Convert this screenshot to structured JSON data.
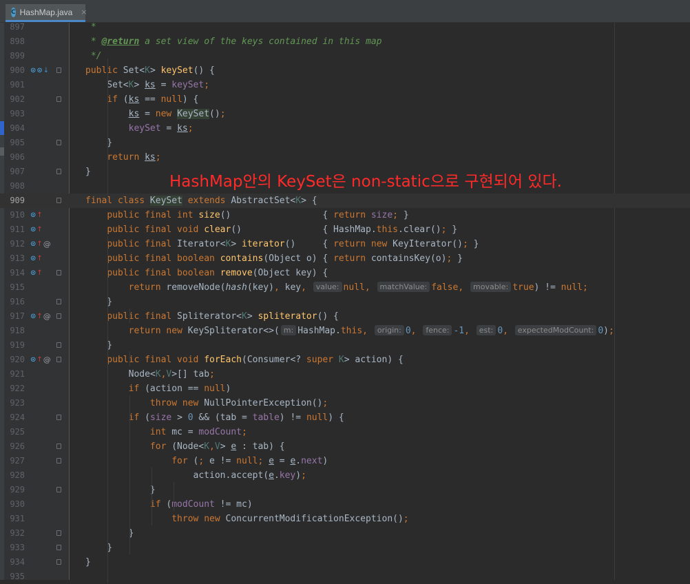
{
  "tab": {
    "icon": "java-class-icon",
    "title": "HashMap.java",
    "close": "×"
  },
  "annotation": "HashMap안의 KeySet은 non-static으로 구현되어 있다.",
  "current_line": "909",
  "lines": [
    {
      "n": "897",
      "icons": [],
      "fold": false,
      "html": "<span class=\"cm\"> *</span>"
    },
    {
      "n": "898",
      "icons": [],
      "fold": false,
      "html": "<span class=\"cm\"> * </span><span class=\"tag\">@return</span><span class=\"cm\"> a set view of the keys contained in this map</span>"
    },
    {
      "n": "899",
      "icons": [],
      "fold": false,
      "html": "<span class=\"cm\"> */</span>"
    },
    {
      "n": "900",
      "icons": [
        "o",
        "o",
        "down"
      ],
      "fold": true,
      "html": "<span class=\"kw\">public</span> Set&lt;<span class=\"tp\">K</span>&gt; <span class=\"mth\">keySet</span>() {"
    },
    {
      "n": "901",
      "icons": [],
      "fold": false,
      "html": "    Set&lt;<span class=\"tp\">K</span>&gt; <span class=\"ul\">ks</span> = <span class=\"fld\">keySet</span><span class=\"kw\">;</span>"
    },
    {
      "n": "902",
      "icons": [],
      "fold": true,
      "html": "    <span class=\"kw\">if</span> (<span class=\"ul\">ks</span> == <span class=\"kw\">null</span>) {"
    },
    {
      "n": "903",
      "icons": [],
      "fold": false,
      "html": "        <span class=\"ul\">ks</span> = <span class=\"kw\">new</span> <span class=\"hl\">KeySet</span>()<span class=\"kw\">;</span>"
    },
    {
      "n": "904",
      "icons": [],
      "fold": false,
      "html": "        <span class=\"fld\">keySet</span> = <span class=\"ul\">ks</span><span class=\"kw\">;</span>"
    },
    {
      "n": "905",
      "icons": [],
      "fold": true,
      "html": "    }"
    },
    {
      "n": "906",
      "icons": [],
      "fold": false,
      "html": "    <span class=\"kw\">return</span> <span class=\"ul\">ks</span><span class=\"kw\">;</span>"
    },
    {
      "n": "907",
      "icons": [],
      "fold": true,
      "html": "}"
    },
    {
      "n": "908",
      "icons": [],
      "fold": false,
      "html": ""
    },
    {
      "n": "909",
      "icons": [],
      "fold": true,
      "html": "<span class=\"kw\">final class</span> <span class=\"hl\">KeySet</span> <span class=\"kw\">extends</span> AbstractSet&lt;<span class=\"tp\">K</span>&gt; {"
    },
    {
      "n": "910",
      "icons": [
        "o",
        "up"
      ],
      "fold": false,
      "html": "    <span class=\"kw\">public final int</span> <span class=\"mth\">size</span>()                 { <span class=\"kw\">return</span> <span class=\"fld\">size</span><span class=\"kw\">;</span> }"
    },
    {
      "n": "911",
      "icons": [
        "o",
        "up"
      ],
      "fold": false,
      "html": "    <span class=\"kw\">public final void</span> <span class=\"mth\">clear</span>()               { HashMap.<span class=\"kw\">this</span>.clear()<span class=\"kw\">;</span> }"
    },
    {
      "n": "912",
      "icons": [
        "o",
        "up",
        "at"
      ],
      "fold": false,
      "html": "    <span class=\"kw\">public final</span> Iterator&lt;<span class=\"tp\">K</span>&gt; <span class=\"mth\">iterator</span>()     { <span class=\"kw\">return new</span> KeyIterator()<span class=\"kw\">;</span> }"
    },
    {
      "n": "913",
      "icons": [
        "o",
        "up"
      ],
      "fold": false,
      "html": "    <span class=\"kw\">public final boolean</span> <span class=\"mth\">contains</span>(Object o) { <span class=\"kw\">return</span> containsKey(o)<span class=\"kw\">;</span> }"
    },
    {
      "n": "914",
      "icons": [
        "o",
        "up"
      ],
      "fold": true,
      "html": "    <span class=\"kw\">public final boolean</span> <span class=\"mth\">remove</span>(Object key) {"
    },
    {
      "n": "915",
      "icons": [],
      "fold": false,
      "html": "        <span class=\"kw\">return</span> removeNode(<span class=\"ital\">hash</span>(key)<span class=\"kw\">,</span> key<span class=\"kw\">,</span> <span class=\"hint\">value:</span><span class=\"kw\">null,</span> <span class=\"hint\">matchValue:</span><span class=\"kw\">false,</span> <span class=\"hint\">movable:</span><span class=\"kw\">true</span>) != <span class=\"kw\">null;</span>"
    },
    {
      "n": "916",
      "icons": [],
      "fold": true,
      "html": "    }"
    },
    {
      "n": "917",
      "icons": [
        "o",
        "up",
        "at"
      ],
      "fold": true,
      "html": "    <span class=\"kw\">public final</span> Spliterator&lt;<span class=\"tp\">K</span>&gt; <span class=\"mth\">spliterator</span>() {"
    },
    {
      "n": "918",
      "icons": [],
      "fold": false,
      "html": "        <span class=\"kw\">return new</span> KeySpliterator&lt;&gt;(<span class=\"hint\">m:</span>HashMap.<span class=\"kw\">this,</span> <span class=\"hint\">origin:</span><span class=\"num\">0</span><span class=\"kw\">,</span> <span class=\"hint\">fence:</span><span class=\"num\">-1</span><span class=\"kw\">,</span> <span class=\"hint\">est:</span><span class=\"num\">0</span><span class=\"kw\">,</span> <span class=\"hint\">expectedModCount:</span><span class=\"num\">0</span>)<span class=\"kw\">;</span>"
    },
    {
      "n": "919",
      "icons": [],
      "fold": true,
      "html": "    }"
    },
    {
      "n": "920",
      "icons": [
        "o",
        "up",
        "at"
      ],
      "fold": true,
      "html": "    <span class=\"kw\">public final void</span> <span class=\"mth\">forEach</span>(Consumer&lt;? <span class=\"kw\">super</span> <span class=\"tp\">K</span>&gt; action) {"
    },
    {
      "n": "921",
      "icons": [],
      "fold": false,
      "html": "        Node&lt;<span class=\"tp\">K</span><span class=\"kw\">,</span><span class=\"tp\">V</span>&gt;[] tab<span class=\"kw\">;</span>"
    },
    {
      "n": "922",
      "icons": [],
      "fold": false,
      "html": "        <span class=\"kw\">if</span> (action == <span class=\"kw\">null</span>)"
    },
    {
      "n": "923",
      "icons": [],
      "fold": false,
      "html": "            <span class=\"kw\">throw new</span> NullPointerException()<span class=\"kw\">;</span>"
    },
    {
      "n": "924",
      "icons": [],
      "fold": true,
      "html": "        <span class=\"kw\">if</span> (<span class=\"fld\">size</span> &gt; <span class=\"num\">0</span> &amp;&amp; (tab = <span class=\"fld\">table</span>) != <span class=\"kw\">null</span>) {"
    },
    {
      "n": "925",
      "icons": [],
      "fold": false,
      "html": "            <span class=\"kw\">int</span> mc = <span class=\"fld\">modCount</span><span class=\"kw\">;</span>"
    },
    {
      "n": "926",
      "icons": [],
      "fold": true,
      "html": "            <span class=\"kw\">for</span> (Node&lt;<span class=\"tp\">K</span><span class=\"kw\">,</span><span class=\"tp\">V</span>&gt; <span class=\"ul\">e</span> : tab) {"
    },
    {
      "n": "927",
      "icons": [],
      "fold": true,
      "html": "                <span class=\"kw\">for</span> (<span class=\"kw\">;</span> e != <span class=\"kw\">null;</span> <span class=\"ul\">e</span> = <span class=\"ul\">e</span>.<span class=\"fld\">next</span>)"
    },
    {
      "n": "928",
      "icons": [],
      "fold": false,
      "html": "                    action.accept(<span class=\"ul\">e</span>.<span class=\"fld\">key</span>)<span class=\"kw\">;</span>"
    },
    {
      "n": "929",
      "icons": [],
      "fold": true,
      "html": "            }"
    },
    {
      "n": "930",
      "icons": [],
      "fold": false,
      "html": "            <span class=\"kw\">if</span> (<span class=\"fld\">modCount</span> != mc)"
    },
    {
      "n": "931",
      "icons": [],
      "fold": false,
      "html": "                <span class=\"kw\">throw new</span> ConcurrentModificationException()<span class=\"kw\">;</span>"
    },
    {
      "n": "932",
      "icons": [],
      "fold": true,
      "html": "        }"
    },
    {
      "n": "933",
      "icons": [],
      "fold": true,
      "html": "    }"
    },
    {
      "n": "934",
      "icons": [],
      "fold": true,
      "html": "}"
    },
    {
      "n": "935",
      "icons": [],
      "fold": false,
      "html": ""
    }
  ]
}
